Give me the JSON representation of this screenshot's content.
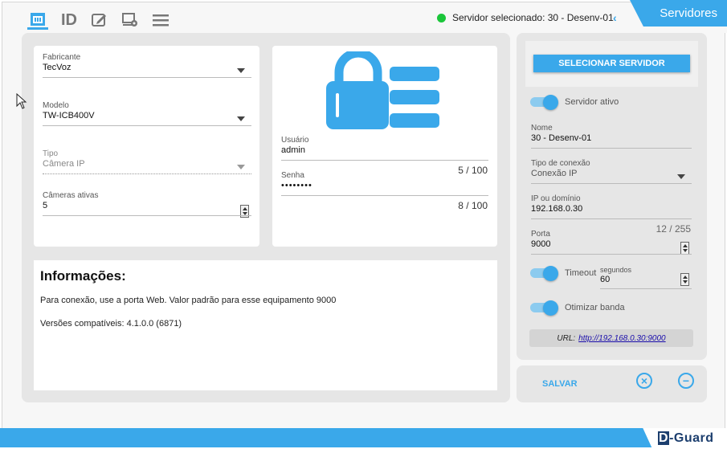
{
  "header": {
    "icons": [
      "network-icon",
      "id-icon",
      "edit-icon",
      "camera-settings-icon",
      "menu-icon"
    ],
    "id_label": "ID",
    "server_status": "Servidor selecionado: 30 - Desenv-01",
    "collapse_arrow": "‹",
    "panel_title": "Servidores"
  },
  "device": {
    "fabricante": {
      "label": "Fabricante",
      "value": "TecVoz"
    },
    "modelo": {
      "label": "Modelo",
      "value": "TW-ICB400V"
    },
    "tipo": {
      "label": "Tipo",
      "value": "Câmera IP"
    },
    "cameras_ativas": {
      "label": "Câmeras ativas",
      "value": "5"
    }
  },
  "credentials": {
    "usuario": {
      "label": "Usuário",
      "value": "admin",
      "counter": "5 / 100"
    },
    "senha": {
      "label": "Senha",
      "value": "••••••••",
      "counter": "8 / 100"
    }
  },
  "info": {
    "title": "Informações:",
    "line1": "Para conexão, use a porta Web. Valor padrão para esse equipamento 9000",
    "line2": "Versões compatíveis: 4.1.0.0 (6871)"
  },
  "server": {
    "select_button": "SELECIONAR SERVIDOR",
    "active_label": "Servidor ativo",
    "nome": {
      "label": "Nome",
      "value": "30 - Desenv-01"
    },
    "tipo_conexao": {
      "label": "Tipo de conexão",
      "value": "Conexão IP"
    },
    "ip": {
      "label": "IP ou domínio",
      "value": "192.168.0.30",
      "counter": "12 / 255"
    },
    "porta": {
      "label": "Porta",
      "value": "9000"
    },
    "timeout": {
      "label": "Timeout",
      "unit": "segundos",
      "value": "60"
    },
    "otimizar_label": "Otimizar banda",
    "url_label": "URL:",
    "url_value": "http://192.168.0.30:9000"
  },
  "actions": {
    "save": "SALVAR",
    "cancel_glyph": "×",
    "remove_glyph": "−"
  },
  "footer": {
    "logo_d": "D",
    "logo_rest": "-Guard"
  },
  "colors": {
    "accent": "#3aa8ea",
    "status_online": "#1bc63a",
    "logo_navy": "#1c3e6e"
  }
}
